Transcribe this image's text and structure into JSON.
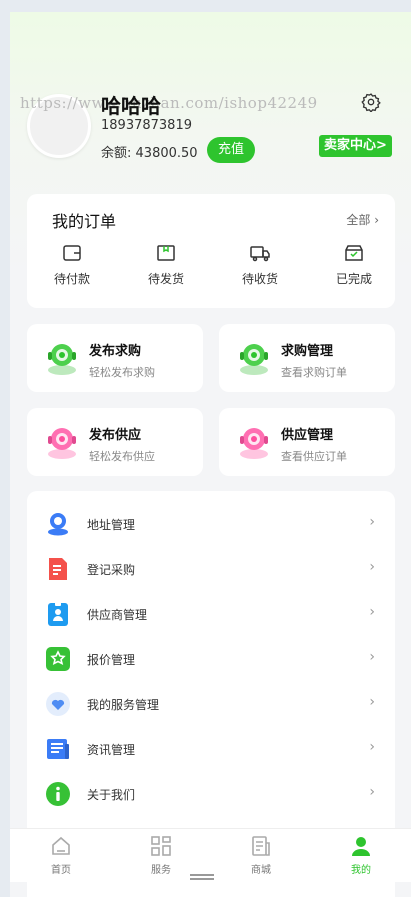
{
  "profile": {
    "name": "哈哈哈",
    "watermark": "https://www.huzhan.com/ishop42249",
    "phone": "18937873819",
    "balance_label": "余额:",
    "balance_value": "43800.50",
    "recharge": "充值",
    "seller_center": "卖家中心>"
  },
  "orders": {
    "title": "我的订单",
    "all": "全部",
    "items": [
      {
        "label": "待付款",
        "icon": "wallet-icon"
      },
      {
        "label": "待发货",
        "icon": "package-icon"
      },
      {
        "label": "待收货",
        "icon": "truck-icon"
      },
      {
        "label": "已完成",
        "icon": "done-box-icon"
      }
    ]
  },
  "tiles": [
    {
      "title": "发布求购",
      "sub": "轻松发布求购",
      "color": "#2ec42e"
    },
    {
      "title": "求购管理",
      "sub": "查看求购订单",
      "color": "#2ec42e"
    },
    {
      "title": "发布供应",
      "sub": "轻松发布供应",
      "color": "#ff5aa5"
    },
    {
      "title": "供应管理",
      "sub": "查看供应订单",
      "color": "#ff5aa5"
    }
  ],
  "menu": [
    {
      "label": "地址管理",
      "icon": "location-icon",
      "color": "#3b7cf6"
    },
    {
      "label": "登记采购",
      "icon": "document-icon",
      "color": "#f4514b"
    },
    {
      "label": "供应商管理",
      "icon": "badge-icon",
      "color": "#1e9bf0"
    },
    {
      "label": "报价管理",
      "icon": "quote-icon",
      "color": "#37c136"
    },
    {
      "label": "我的服务管理",
      "icon": "heart-icon",
      "color": "#4f8df3"
    },
    {
      "label": "资讯管理",
      "icon": "news-icon",
      "color": "#3b7cf6"
    },
    {
      "label": "关于我们",
      "icon": "info-icon",
      "color": "#37c136"
    }
  ],
  "tabs": [
    {
      "label": "首页",
      "active": false
    },
    {
      "label": "服务",
      "active": false
    },
    {
      "label": "商城",
      "active": false
    },
    {
      "label": "我的",
      "active": true
    }
  ],
  "colors": {
    "accent": "#2ec42e"
  }
}
